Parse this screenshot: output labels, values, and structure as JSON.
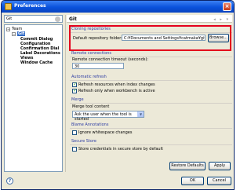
{
  "window": {
    "title": "Preferences"
  },
  "filter": {
    "value": "Git"
  },
  "tree": {
    "team": "Team",
    "git": "Git",
    "children": [
      "Commit Dialog",
      "Configuration",
      "Confirmation Dial",
      "Label Decorations",
      "Views",
      "Window Cache"
    ]
  },
  "page": {
    "title": "Git"
  },
  "cloning": {
    "header": "Cloning repositories",
    "folder_label": "Default repository folder:",
    "folder_value": "C:¥Documents and Settings¥catmaka¥git",
    "browse": "Browse..."
  },
  "remote": {
    "header": "Remote connections",
    "timeout_label": "Remote connection timeout (seconds):",
    "timeout_value": "30"
  },
  "auto_refresh": {
    "header": "Automatic refresh",
    "opt1": "Refresh resources when index changes",
    "opt2": "Refresh only when workbench is active"
  },
  "merge": {
    "header": "Merge",
    "tool_label": "Merge tool content",
    "tool_value": "Ask the user when the tool is started"
  },
  "blame": {
    "header": "Blame Annotations",
    "opt": "Ignore whitespace changes"
  },
  "secure": {
    "header": "Secure Store",
    "opt": "Store credentials in secure store by default"
  },
  "buttons": {
    "restore": "Restore Defaults",
    "apply": "Apply",
    "ok": "OK",
    "cancel": "Cancel"
  },
  "colors": {
    "accent": "#316ac5",
    "highlight_border": "#e4001c",
    "group_header": "#2d3ca3"
  }
}
